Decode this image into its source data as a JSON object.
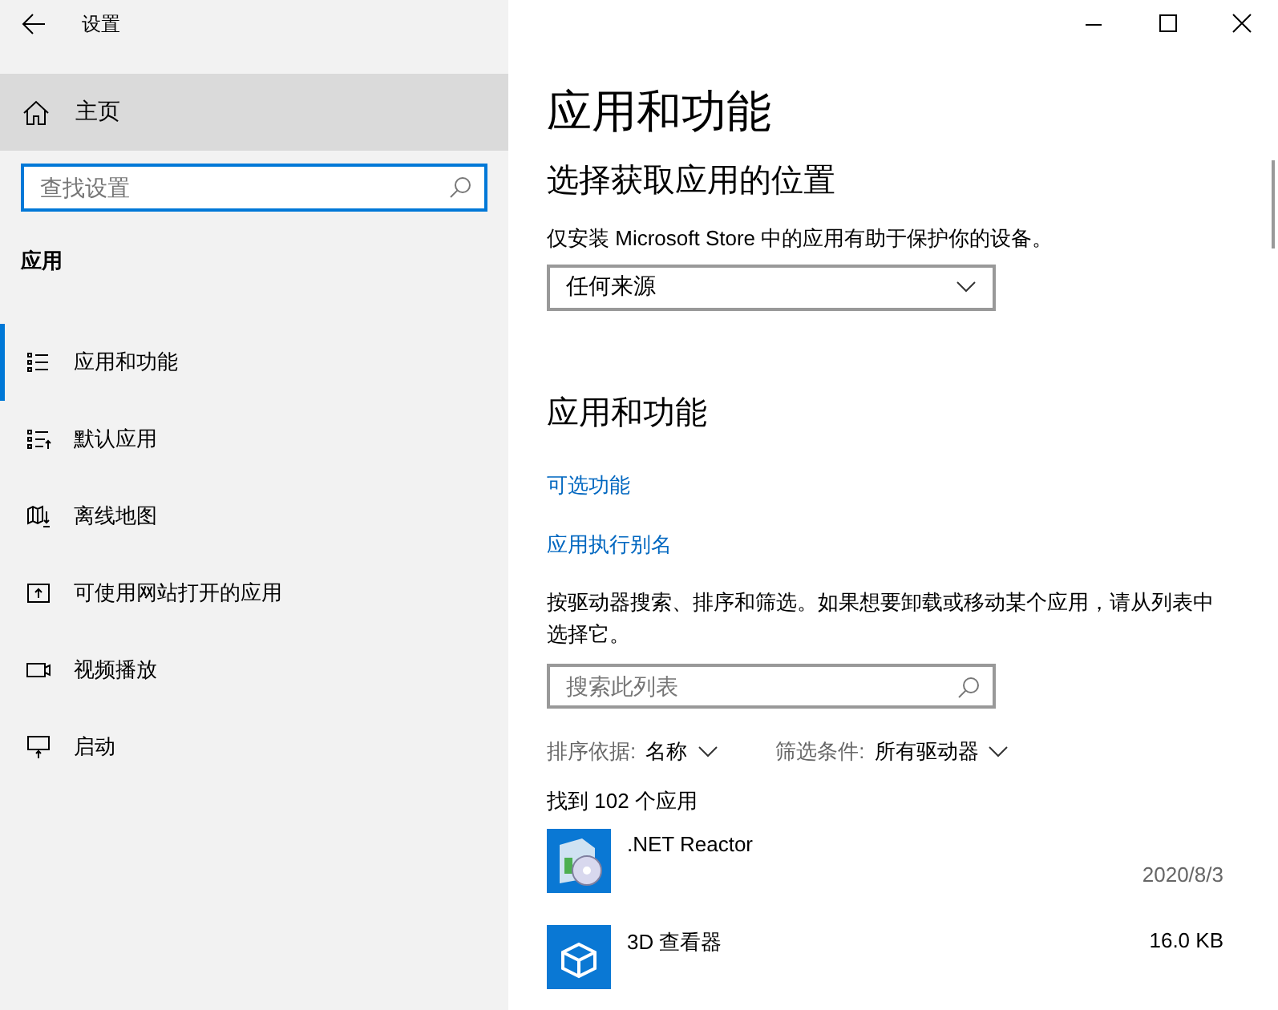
{
  "window": {
    "title": "设置"
  },
  "sidebar": {
    "home": {
      "label": "主页",
      "selected": true
    },
    "search": {
      "placeholder": "查找设置"
    },
    "section": "应用",
    "items": [
      {
        "label": "应用和功能",
        "kind": "list",
        "selected": true
      },
      {
        "label": "默认应用",
        "kind": "defaults",
        "selected": false
      },
      {
        "label": "离线地图",
        "kind": "map",
        "selected": false
      },
      {
        "label": "可使用网站打开的应用",
        "kind": "web",
        "selected": false
      },
      {
        "label": "视频播放",
        "kind": "video",
        "selected": false
      },
      {
        "label": "启动",
        "kind": "startup",
        "selected": false
      }
    ]
  },
  "main": {
    "title": "应用和功能",
    "source": {
      "heading": "选择获取应用的位置",
      "description": "仅安装 Microsoft Store 中的应用有助于保护你的设备。",
      "dropdown": "任何来源"
    },
    "apps_section": {
      "heading": "应用和功能",
      "links": [
        "可选功能",
        "应用执行别名"
      ],
      "description": "按驱动器搜索、排序和筛选。如果想要卸载或移动某个应用，请从列表中选择它。",
      "search": {
        "placeholder": "搜索此列表"
      },
      "sort": {
        "label": "排序依据:",
        "value": "名称"
      },
      "filter": {
        "label": "筛选条件:",
        "value": "所有驱动器"
      },
      "count": "找到 102 个应用",
      "apps": [
        {
          "name": ".NET Reactor",
          "kind": "installer",
          "date": "2020/8/3"
        },
        {
          "name": "3D 查看器",
          "kind": "cube",
          "size": "16.0 KB"
        }
      ]
    }
  }
}
